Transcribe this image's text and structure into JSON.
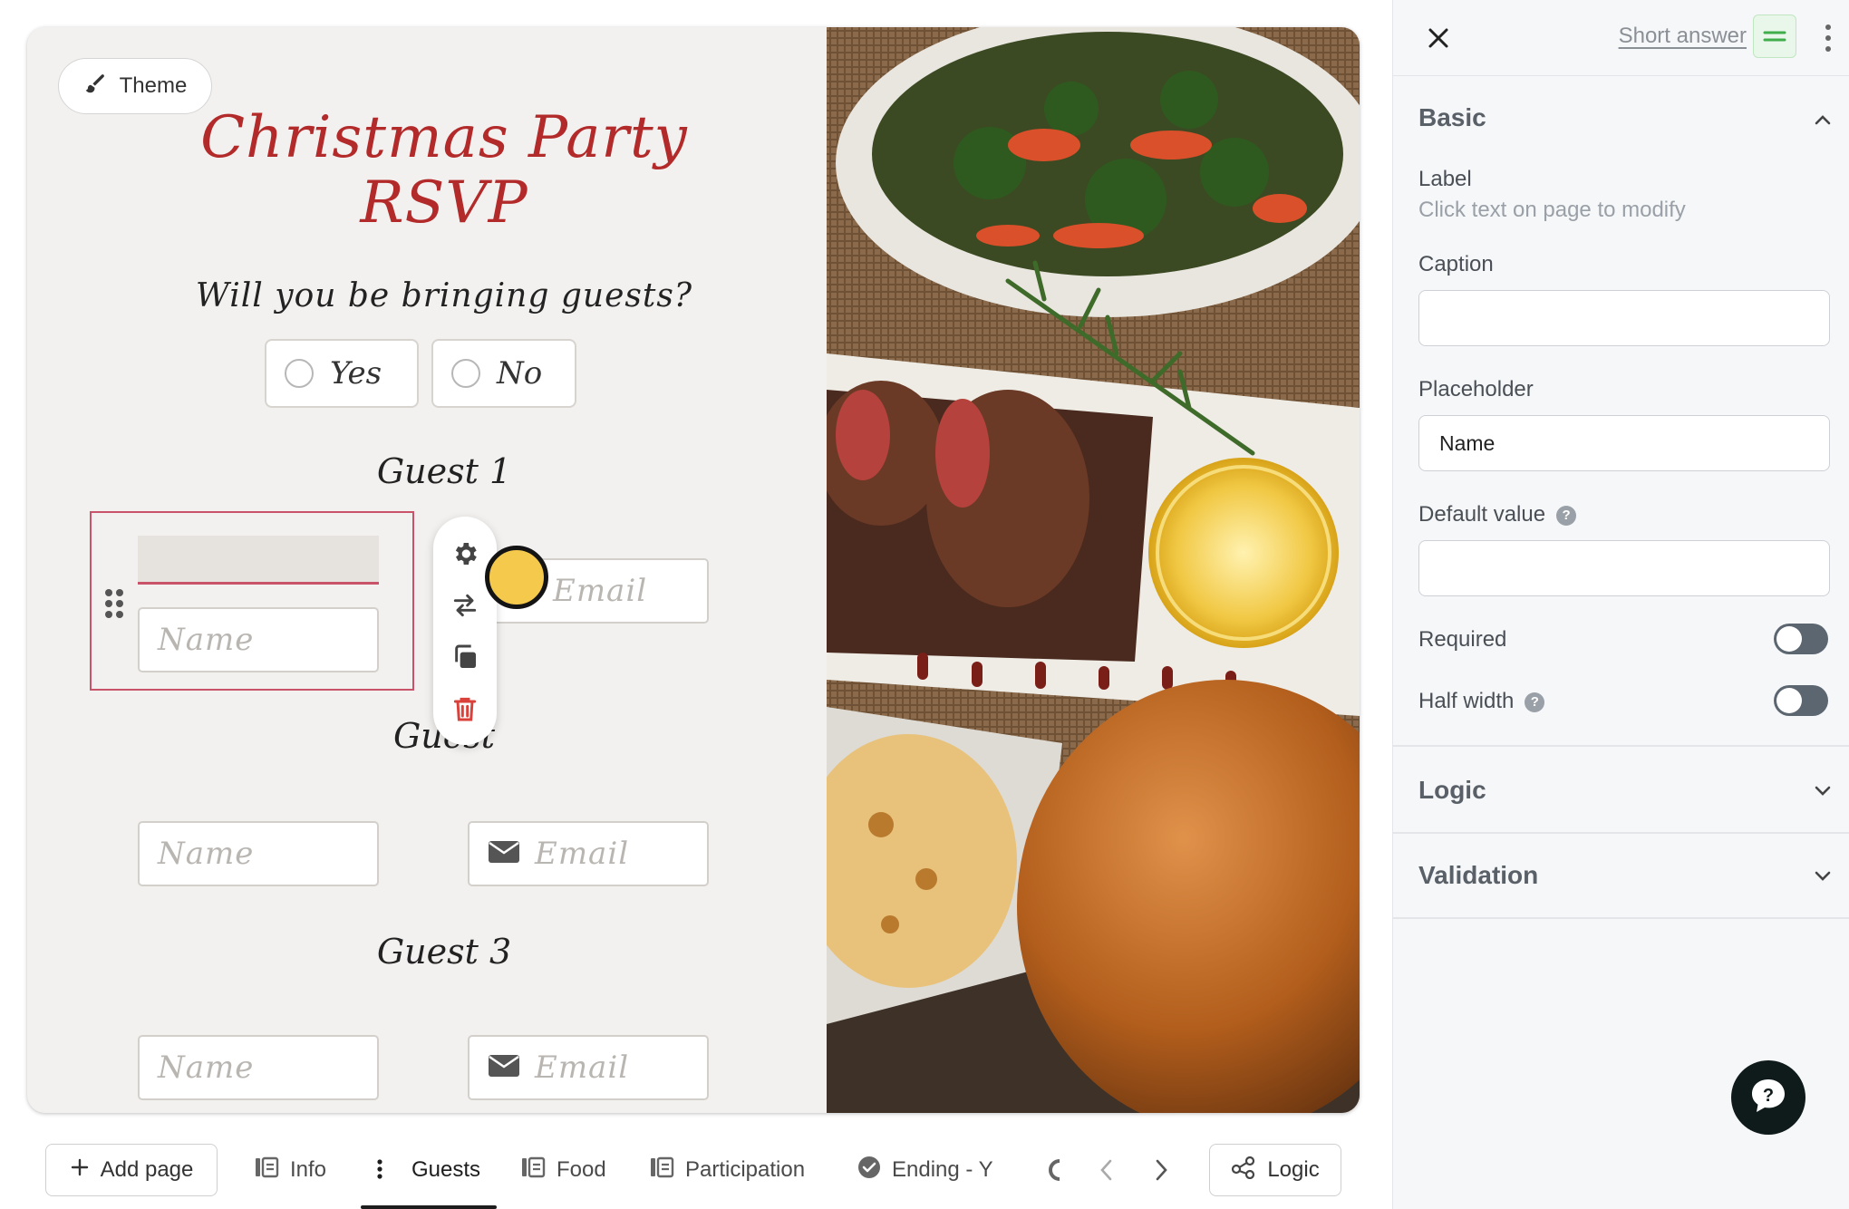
{
  "canvas": {
    "theme_label": "Theme",
    "title_line1": "Christmas Party",
    "title_line2": "RSVP",
    "question": "Will you be bringing guests?",
    "choices": [
      "Yes",
      "No"
    ],
    "guests": [
      {
        "title": "Guest 1",
        "name_placeholder": "Name",
        "email_placeholder": "Email"
      },
      {
        "title": "Guest",
        "name_placeholder": "Name",
        "email_placeholder": "Email"
      },
      {
        "title": "Guest 3",
        "name_placeholder": "Name",
        "email_placeholder": "Email"
      }
    ],
    "colors": {
      "title": "#b32a2a",
      "selection": "#c9546a",
      "cursor": "#f5c94c"
    }
  },
  "tabs": {
    "add_page": "Add page",
    "items": [
      {
        "label": "Info",
        "icon": "page-icon"
      },
      {
        "label": "Guests",
        "icon": "more-vertical-icon",
        "active": true
      },
      {
        "label": "Food",
        "icon": "page-icon"
      },
      {
        "label": "Participation",
        "icon": "page-icon"
      },
      {
        "label": "Ending - Y",
        "icon": "check-circle-icon"
      }
    ],
    "logic": "Logic"
  },
  "panel": {
    "field_type": "Short answer",
    "sections": {
      "basic": "Basic",
      "logic": "Logic",
      "validation": "Validation"
    },
    "label_title": "Label",
    "label_hint": "Click text on page to modify",
    "caption_title": "Caption",
    "caption_value": "",
    "placeholder_title": "Placeholder",
    "placeholder_value": "Name",
    "default_title": "Default value",
    "default_value": "",
    "required_label": "Required",
    "half_width_label": "Half width",
    "required_on": false,
    "half_width_on": false
  }
}
